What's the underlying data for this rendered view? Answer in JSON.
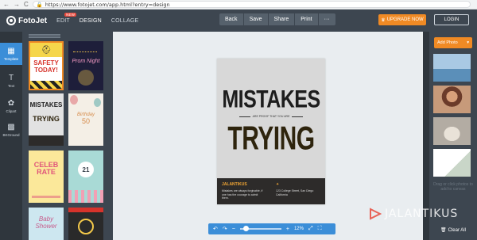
{
  "browser": {
    "url": "https://www.fotojet.com/app.html?entry=design",
    "nav_back": "←",
    "nav_forward": "→",
    "nav_reload": "C"
  },
  "header": {
    "logo_text": "FotoJet",
    "modes": [
      "EDIT",
      "DESIGN",
      "COLLAGE"
    ],
    "active_mode": "DESIGN",
    "new_badge": "NEW",
    "toolbar": [
      "Back",
      "Save",
      "Share",
      "Print",
      "···"
    ],
    "upgrade_label": "UPGRADE NOW",
    "login_label": "LOGIN",
    "accent_color": "#f08a24"
  },
  "rail": {
    "items": [
      {
        "label": "Template",
        "icon": "template-icon"
      },
      {
        "label": "Text",
        "icon": "text-icon"
      },
      {
        "label": "Clipart",
        "icon": "clipart-icon"
      },
      {
        "label": "BKGround",
        "icon": "background-icon"
      }
    ],
    "active": "Template"
  },
  "templates": [
    {
      "line1": "SAFETY",
      "line2": "TODAY!"
    },
    {
      "line1": "Prom Night",
      "line2": ""
    },
    {
      "line1": "MISTAKES",
      "line2": "TRYING"
    },
    {
      "line1": "Birthday",
      "line2": "50"
    },
    {
      "line1": "CELEB",
      "line2": "RATE"
    },
    {
      "line1": "21",
      "line2": ""
    },
    {
      "line1": "Baby",
      "line2": "Shower"
    },
    {
      "line1": "",
      "line2": ""
    }
  ],
  "poster": {
    "headline": "MISTAKES",
    "subhead": "ARE PROOF THAT YOU ARE",
    "word": "TRYING",
    "brand": "JALANTIKUS",
    "desc": "Mistakes are always forgivable, if one has the courage to admit them.",
    "badge": "✦",
    "address": "123 College Street, San Diego California",
    "bg_color": "#d8d8d8",
    "footer_color": "#2d2b2a"
  },
  "zoom": {
    "undo": "↶",
    "redo": "↷",
    "minus": "−",
    "plus": "+",
    "value": "12%",
    "fit": "⤢",
    "fullscreen": "⛶"
  },
  "right": {
    "add_photo_label": "Add Photo",
    "drop_text": "Drag or click photos to add to canvas",
    "clear_all_label": "Clear All"
  },
  "watermark": "JALANTIKUS"
}
